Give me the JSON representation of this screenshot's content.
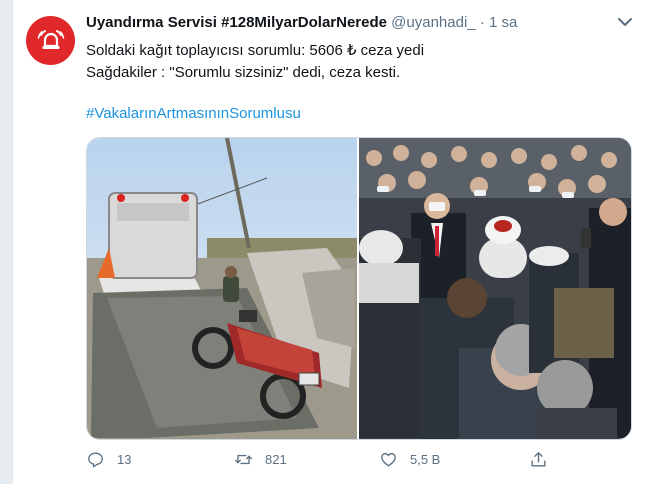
{
  "tweet": {
    "display_name": "Uyandırma Servisi #128MilyarDolarNerede",
    "handle": "@uyanhadi_",
    "separator": "·",
    "time": "1 sa",
    "text": "Soldaki kağıt toplayıcısı sorumlu: 5606 ₺ ceza yedi\nSağdakiler : \"Sorumlu sizsiniz\" dedi, ceza kesti.",
    "hashtag": "#VakalarınArtmasınınSorumlusu"
  },
  "actions": {
    "reply_count": "13",
    "retweet_count": "821",
    "like_count": "5,5 B"
  },
  "icons": {
    "avatar": "alarm-bell-icon",
    "more": "more-icon",
    "reply": "reply-icon",
    "retweet": "retweet-icon",
    "like": "heart-icon",
    "share": "share-icon"
  },
  "colors": {
    "accent": "#1b95e0",
    "avatar_bg": "#e0282a",
    "muted": "#5b7083"
  }
}
